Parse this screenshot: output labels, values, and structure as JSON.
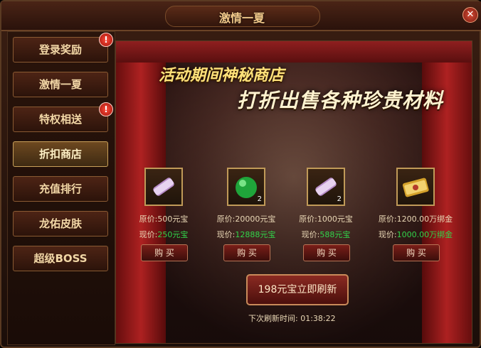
{
  "window": {
    "title": "激情一夏"
  },
  "sidebar": {
    "items": [
      {
        "label": "登录奖励",
        "alert": "!"
      },
      {
        "label": "激情一夏"
      },
      {
        "label": "特权相送",
        "alert": "!"
      },
      {
        "label": "折扣商店"
      },
      {
        "label": "充值排行"
      },
      {
        "label": "龙佑皮肤"
      },
      {
        "label": "超级BOSS"
      }
    ]
  },
  "banner": {
    "line1": "活动期间神秘商店",
    "line2": "打折出售各种珍贵材料"
  },
  "shop": {
    "items": [
      {
        "icon": "scroll-icon",
        "count": "",
        "orig_label": "原价:",
        "orig_value": "500元宝",
        "now_label": "现价:",
        "now_value": "250元宝",
        "buy": "购 买"
      },
      {
        "icon": "green-orb-icon",
        "count": "2",
        "orig_label": "原价:",
        "orig_value": "20000元宝",
        "now_label": "现价:",
        "now_value": "12888元宝",
        "buy": "购 买"
      },
      {
        "icon": "scroll-icon",
        "count": "2",
        "orig_label": "原价:",
        "orig_value": "1000元宝",
        "now_label": "现价:",
        "now_value": "588元宝",
        "buy": "购 买"
      },
      {
        "icon": "gold-scroll-icon",
        "count": "",
        "orig_label": "原价:",
        "orig_value": "1200.00万绑金",
        "now_label": "现价:",
        "now_value": "1000.00万绑金",
        "buy": "购 买"
      }
    ],
    "refresh_button": "198元宝立即刷新",
    "timer_label": "下次刷新时间:",
    "timer_value": "01:38:22"
  }
}
